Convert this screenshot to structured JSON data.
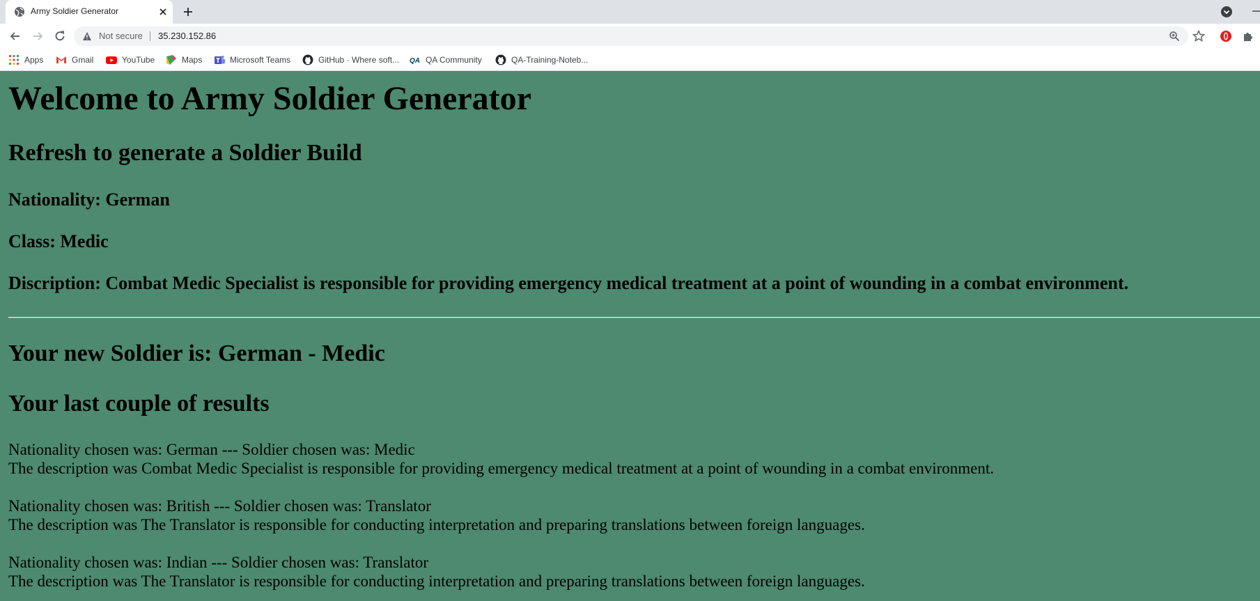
{
  "browser": {
    "tab_title": "Army Soldier Generator",
    "security_label": "Not secure",
    "url": "35.230.152.86",
    "bookmarks": [
      {
        "label": "Apps",
        "icon": "apps-grid-icon"
      },
      {
        "label": "Gmail",
        "icon": "gmail-icon"
      },
      {
        "label": "YouTube",
        "icon": "youtube-icon"
      },
      {
        "label": "Maps",
        "icon": "maps-icon"
      },
      {
        "label": "Microsoft Teams",
        "icon": "teams-icon"
      },
      {
        "label": "GitHub · Where soft...",
        "icon": "github-icon"
      },
      {
        "label": "QA Community",
        "icon": "qa-icon"
      },
      {
        "label": "QA-Training-Noteb...",
        "icon": "github-icon"
      }
    ]
  },
  "page": {
    "title": "Welcome to Army Soldier Generator",
    "subtitle": "Refresh to generate a Soldier Build",
    "nationality_line": "Nationality: German",
    "class_line": "Class: Medic",
    "description_line": "Discription: Combat Medic Specialist is responsible for providing emergency medical treatment at a point of wounding in a combat environment.",
    "new_soldier": "Your new Soldier is: German - Medic",
    "results_heading": "Your last couple of results",
    "results": [
      {
        "summary": "Nationality chosen was: German --- Soldier chosen was: Medic",
        "description": "The description was Combat Medic Specialist is responsible for providing emergency medical treatment at a point of wounding in a combat environment."
      },
      {
        "summary": "Nationality chosen was: British --- Soldier chosen was: Translator",
        "description": "The description was The Translator is responsible for conducting interpretation and preparing translations between foreign languages."
      },
      {
        "summary": "Nationality chosen was: Indian --- Soldier chosen was: Translator",
        "description": "The description was The Translator is responsible for conducting interpretation and preparing translations between foreign languages."
      }
    ],
    "background_color": "#4d8a70"
  }
}
